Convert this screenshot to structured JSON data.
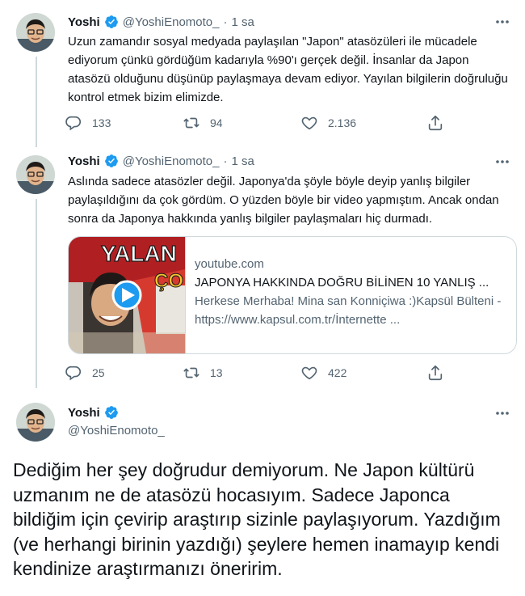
{
  "author": {
    "name": "Yoshi",
    "handle": "@YoshiEnomoto_"
  },
  "colors": {
    "verified": "#1d9bf0",
    "muted": "#536471",
    "divider": "#cfd9de"
  },
  "tweets": [
    {
      "dot": "·",
      "time": "1 sa",
      "text": "Uzun zamandır sosyal medyada paylaşılan \"Japon\" atasözüleri ile mücadele ediyorum çünkü gördüğüm kadarıyla %90'ı gerçek değil. İnsanlar da Japon atasözü olduğunu düşünüp paylaşmaya devam ediyor. Yayılan bilgilerin doğruluğu kontrol etmek bizim elimizde.",
      "replies": "133",
      "retweets": "94",
      "likes": "2.136"
    },
    {
      "dot": "·",
      "time": "1 sa",
      "text": "Aslında sadece atasözler değil. Japonya'da şöyle böyle deyip yanlış bilgiler paylaşıldığını da çok gördüm. O yüzden böyle bir video yapmıştım. Ancak ondan sonra da Japonya hakkında yanlış bilgiler paylaşmaları hiç durmadı.",
      "replies": "25",
      "retweets": "13",
      "likes": "422",
      "card": {
        "thumb_text_1": "YALAN",
        "thumb_text_2": "ÇO",
        "domain": "youtube.com",
        "title": "JAPONYA HAKKINDA DOĞRU BİLİNEN 10 YANLIŞ ...",
        "description": "Herkese Merhaba! Mina san Konniçiwa :)Kapsül Bülteni - https://www.kapsul.com.tr/İnternette ..."
      }
    }
  ],
  "main_tweet": {
    "text": "Dediğim her şey doğrudur demiyorum. Ne Japon kültürü uzmanım ne de atasözü hocasıyım. Sadece Japonca bildiğim için çevirip araştırıp sizinle paylaşıyorum. Yazdığım (ve herhangi birinin yazdığı) şeylere hemen inamayıp kendi kendinize araştırmanızı öneririm."
  },
  "icons": {
    "reply": "reply-icon",
    "retweet": "retweet-icon",
    "like": "heart-icon",
    "share": "share-icon",
    "more": "more-icon",
    "verified": "verified-badge-icon",
    "play": "play-icon"
  }
}
